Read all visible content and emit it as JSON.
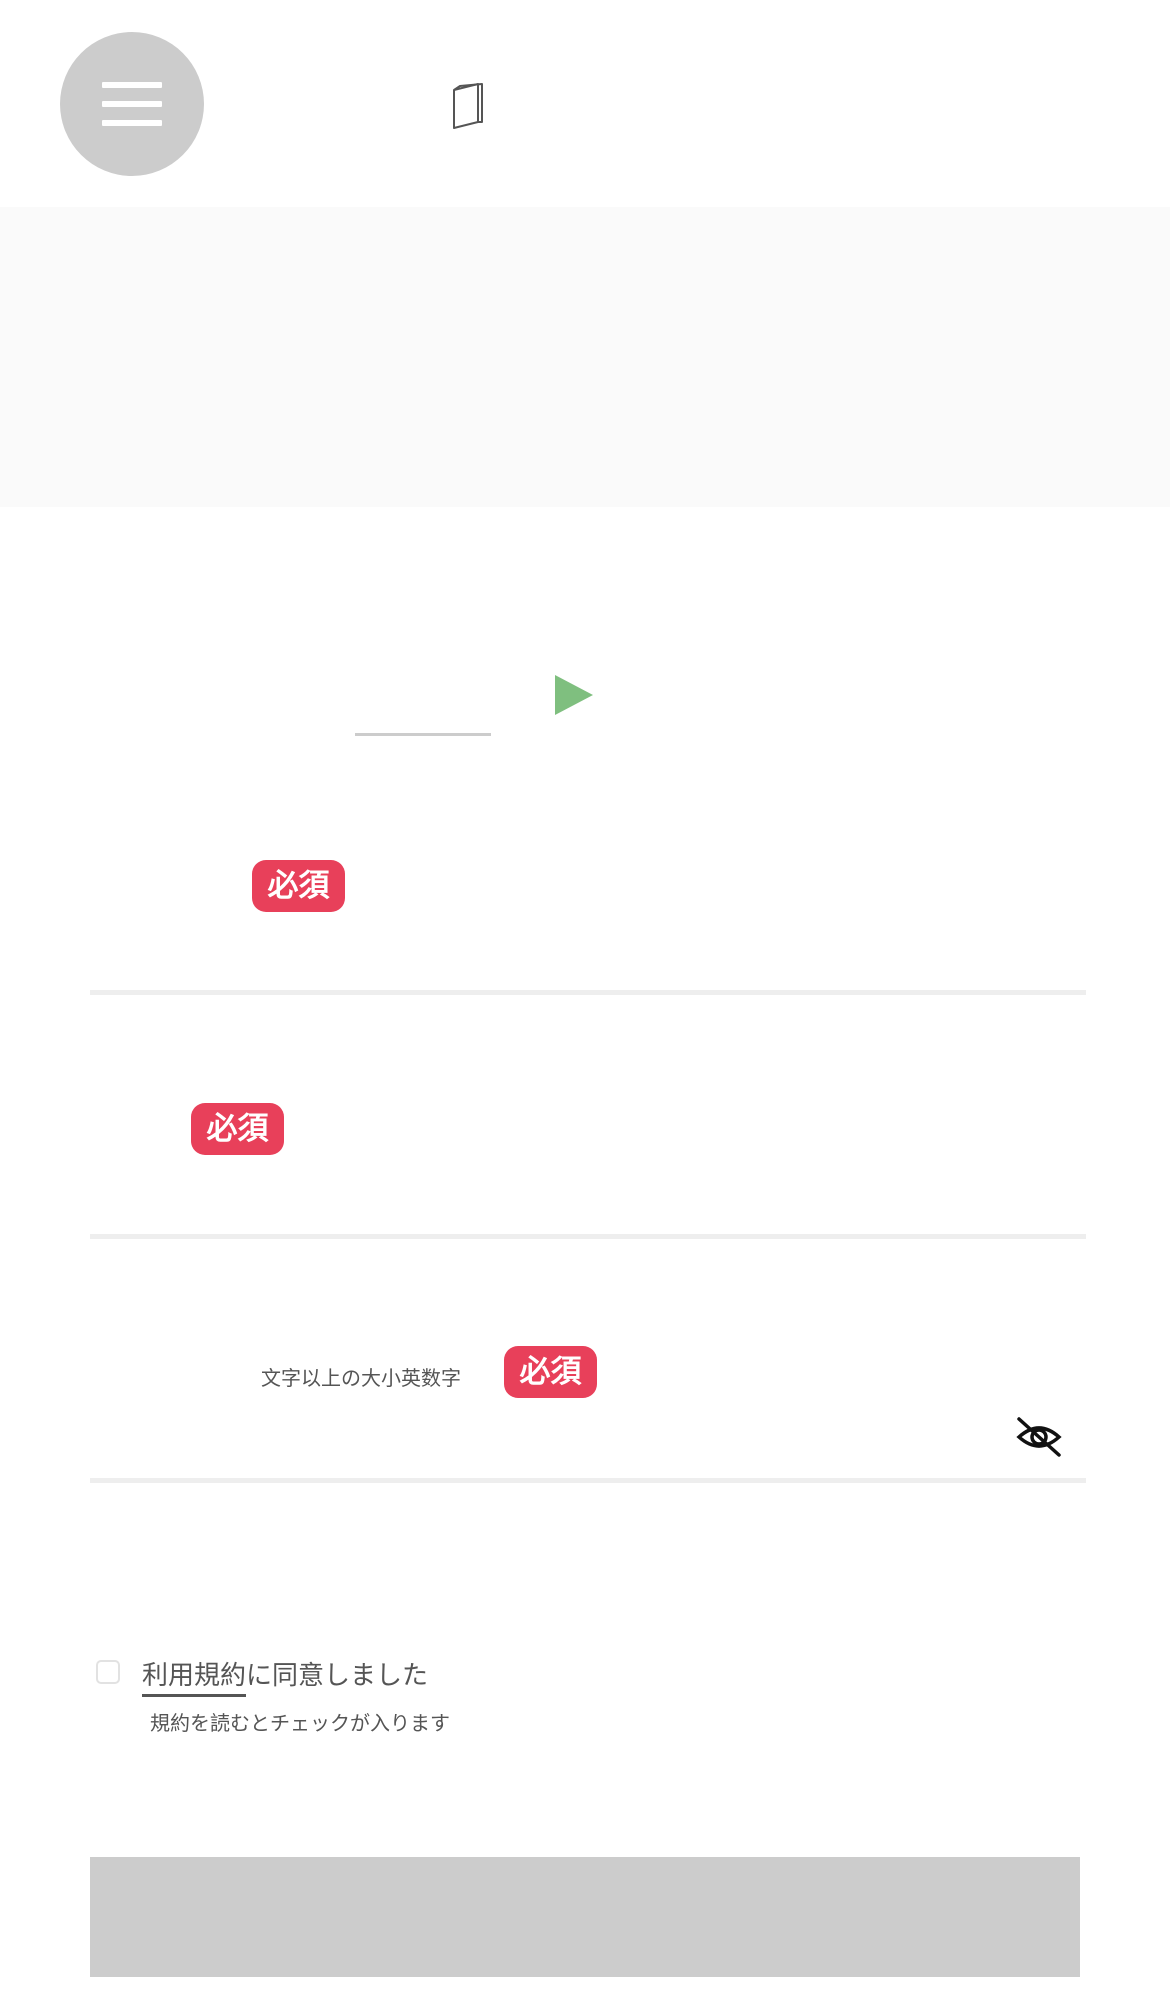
{
  "header": {
    "menu_icon": "hamburger-menu-icon",
    "book_icon": "book-icon"
  },
  "colors": {
    "required_badge": "#e8405a",
    "play_icon": "#7fbf7f",
    "disabled_button": "#cccccc"
  },
  "form": {
    "play_icon": "play-icon",
    "fields": [
      {
        "required_label": "必須"
      },
      {
        "required_label": "必須"
      },
      {
        "hint": "文字以上の大小英数字",
        "required_label": "必須",
        "toggle_icon": "eye-slash-icon"
      }
    ]
  },
  "terms": {
    "link_label": "利用規約",
    "suffix": "に同意しました",
    "note": "規約を読むとチェックが入ります"
  }
}
